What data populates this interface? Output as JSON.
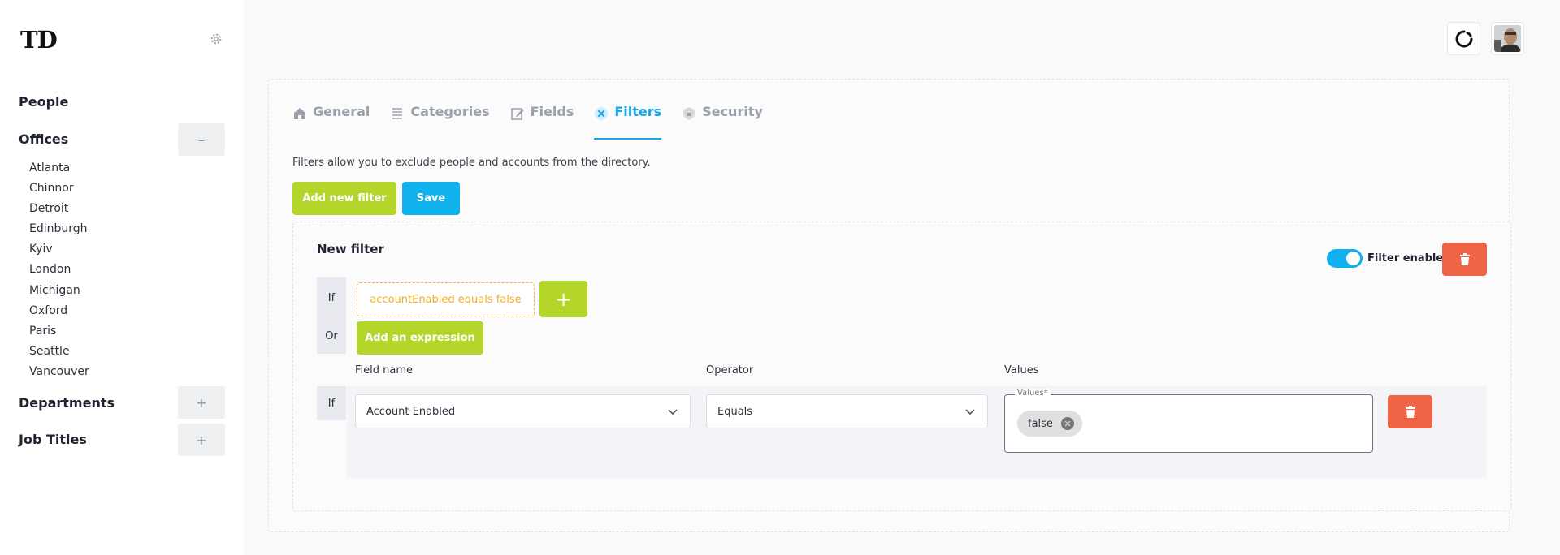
{
  "app": {
    "logo": "TD"
  },
  "sidebar": {
    "people": "People",
    "offices": "Offices",
    "offices_toggle": "–",
    "office_list": [
      "Atlanta",
      "Chinnor",
      "Detroit",
      "Edinburgh",
      "Kyiv",
      "London",
      "Michigan",
      "Oxford",
      "Paris",
      "Seattle",
      "Vancouver"
    ],
    "departments": "Departments",
    "departments_toggle": "+",
    "job_titles": "Job Titles",
    "job_titles_toggle": "+"
  },
  "tabs": [
    {
      "label": "General",
      "icon": "home-icon"
    },
    {
      "label": "Categories",
      "icon": "list-icon"
    },
    {
      "label": "Fields",
      "icon": "edit-icon"
    },
    {
      "label": "Filters",
      "icon": "filter-x-icon",
      "active": true
    },
    {
      "label": "Security",
      "icon": "shield-icon"
    }
  ],
  "filters": {
    "description": "Filters allow you to exclude people and accounts from the directory.",
    "add_new_filter": "Add new filter",
    "save": "Save",
    "new_filter": {
      "title": "New filter",
      "enabled_label": "Filter enabled",
      "enabled": true,
      "if_label": "If",
      "or_label": "Or",
      "expression": "accountEnabled equals false",
      "add_expression_symbol": "+",
      "add_expression": "Add an expression",
      "columns": {
        "field_name": "Field name",
        "operator": "Operator",
        "values": "Values"
      },
      "row": {
        "if_label": "If",
        "field_name": "Account Enabled",
        "operator": "Equals",
        "values_legend": "Values*",
        "values": [
          "false"
        ]
      }
    }
  },
  "colors": {
    "accent_blue": "#0fb2ef",
    "accent_green": "#b4d62b",
    "danger": "#ef6445",
    "expression": "#f0ac26"
  }
}
